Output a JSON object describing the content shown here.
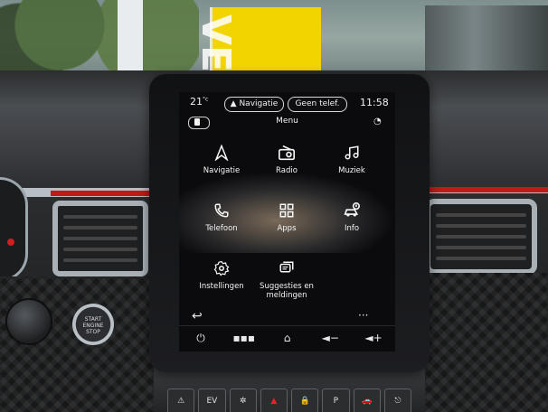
{
  "screen": {
    "status_bar": {
      "temperature": "21",
      "temperature_unit": "°c",
      "navigation_label": "Navigatie",
      "phone_label": "Geen telef.",
      "time": "11:58"
    },
    "menu_title": "Menu",
    "tiles": [
      {
        "id": "navigatie",
        "label": "Navigatie",
        "icon": "navigation-arrow-icon"
      },
      {
        "id": "radio",
        "label": "Radio",
        "icon": "radio-icon"
      },
      {
        "id": "muziek",
        "label": "Muziek",
        "icon": "music-note-icon"
      },
      {
        "id": "telefoon",
        "label": "Telefoon",
        "icon": "phone-icon"
      },
      {
        "id": "apps",
        "label": "Apps",
        "icon": "apps-grid-icon"
      },
      {
        "id": "info",
        "label": "Info",
        "icon": "car-info-icon"
      },
      {
        "id": "instellingen",
        "label": "Instellingen",
        "icon": "gear-icon"
      },
      {
        "id": "suggesties",
        "label_line1": "Suggesties en",
        "label_line2": "meldingen",
        "icon": "messages-icon"
      }
    ],
    "bottom_bar": {
      "back_icon": "back-arrow-icon",
      "more_icon": "more-dots-icon",
      "more_glyph": "···"
    },
    "dock": [
      {
        "name": "power-icon",
        "glyph": "⏻"
      },
      {
        "name": "app-menu-icon",
        "glyph": "▪▪▪"
      },
      {
        "name": "home-icon",
        "glyph": "⌂"
      },
      {
        "name": "volume-down-icon",
        "glyph": "◄−"
      },
      {
        "name": "volume-up-icon",
        "glyph": "◄+"
      }
    ]
  },
  "background": {
    "banner_text": "VE",
    "start_button_text_line1": "START",
    "start_button_text_line2": "ENGINE",
    "start_button_text_line3": "STOP",
    "physical_buttons": [
      "⚠︎",
      "EV",
      "✲",
      "▲",
      "🔒",
      "P",
      "🚗",
      "⎋"
    ]
  },
  "colors": {
    "accent_red": "#c21a1a",
    "banner_yellow": "#f2d400",
    "screen_bg": "#0b0b0d"
  }
}
